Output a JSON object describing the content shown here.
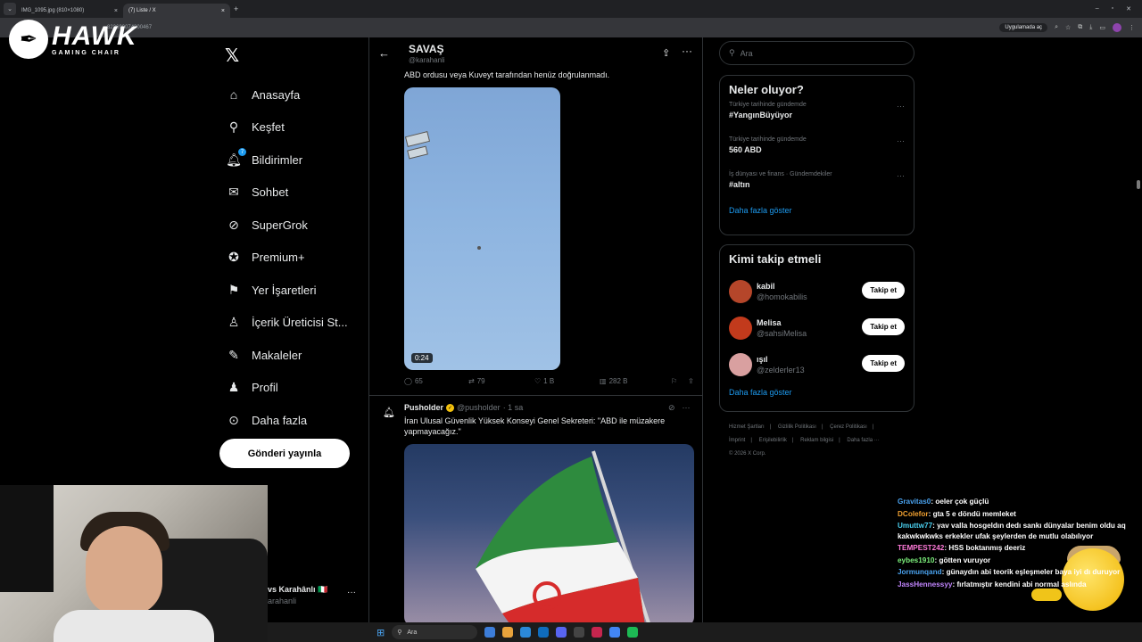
{
  "browser": {
    "tabs": [
      {
        "label": "IMG_1095.jpg (810×1080)",
        "close": "×"
      },
      {
        "label": "(7) Liste / X",
        "close": "×"
      }
    ],
    "new_tab": "+",
    "address": "822690074300467",
    "translate_pill": "Uygulamada aç"
  },
  "overlay_logo": {
    "title": "HAWK",
    "subtitle": "GAMING CHAIR"
  },
  "sidebar": {
    "logo": "𝕏",
    "items": [
      {
        "label": "Anasayfa",
        "icon": "home-icon"
      },
      {
        "label": "Keşfet",
        "icon": "search-icon"
      },
      {
        "label": "Bildirimler",
        "icon": "bell-icon",
        "badge": "7"
      },
      {
        "label": "Sohbet",
        "icon": "mail-icon"
      },
      {
        "label": "SuperGrok",
        "icon": "grok-icon"
      },
      {
        "label": "Premium+",
        "icon": "premium-icon"
      },
      {
        "label": "Yer İşaretleri",
        "icon": "bookmark-icon"
      },
      {
        "label": "İçerik Üreticisi St...",
        "icon": "creator-icon"
      },
      {
        "label": "Makaleler",
        "icon": "article-icon"
      },
      {
        "label": "Profil",
        "icon": "profile-icon"
      },
      {
        "label": "Daha fazla",
        "icon": "more-icon"
      }
    ],
    "post_button": "Gönderi yayınla",
    "account_name": "vs Karahânlı 🇮🇹",
    "account_handle": "arahanli"
  },
  "main": {
    "header_title": "SAVAŞ",
    "header_handle": "@karahanli",
    "tweet1": {
      "text": "ABD ordusu veya Kuveyt tarafından henüz doğrulanmadı.",
      "video_time": "0:24",
      "replies": "65",
      "retweets": "79",
      "likes": "1 B",
      "views": "282 B"
    },
    "tweet2": {
      "name": "Pusholder",
      "handle": "@pusholder",
      "time": "· 1 sa",
      "text": "İran Ulusal Güvenlik Yüksek Konseyi Genel Sekreteri: \"ABD ile müzakere yapmayacağız.\""
    }
  },
  "right": {
    "search_placeholder": "Ara",
    "trends_title": "Neler oluyor?",
    "trends": [
      {
        "context": "Türkiye tarihinde gündemde",
        "name": "#YangınBüyüyor"
      },
      {
        "context": "Türkiye tarihinde gündemde",
        "name": "560 ABD"
      },
      {
        "context": "İş dünyası ve finans · Gündemdekiler",
        "name": "#altın"
      }
    ],
    "trends_more": "Daha fazla göster",
    "follow_title": "Kimi takip etmeli",
    "follow": [
      {
        "name": "kabil",
        "handle": "@homokabilis",
        "button": "Takip et",
        "color": "#b5462a"
      },
      {
        "name": "Melisa",
        "handle": "@sahsiMelisa",
        "button": "Takip et",
        "color": "#c23a1c"
      },
      {
        "name": "ışıl",
        "handle": "@zelderler13",
        "button": "Takip et",
        "color": "#d9a0a0"
      }
    ],
    "follow_more": "Daha fazla göster",
    "footer": [
      "Hizmet Şartları",
      "|",
      "Gizlilik Politikası",
      "|",
      "Çerez Politikası",
      "|",
      "İmprint",
      "|",
      "Erişilebilirlik",
      "|",
      "Reklam bilgisi",
      "|",
      "Daha fazla ···",
      "© 2026 X Corp."
    ]
  },
  "chat": [
    {
      "user": "Gravitas0",
      "color": "#4aa3f0",
      "msg": ": oeler çok güçlü"
    },
    {
      "user": "DColefor",
      "color": "#f0a030",
      "msg": ": gta 5 e döndü memleket"
    },
    {
      "user": "Umuttw77",
      "color": "#4ad0f0",
      "msg": ": yav valla hosgeldın dedı sankı dünyalar benim oldu aq kakwkwkwks erkekler ufak şeylerden de mutlu olabılıyor"
    },
    {
      "user": "TEMPEST242",
      "color": "#ff7ad9",
      "msg": ": HSS boktanmış deeriz"
    },
    {
      "user": "eybes1910",
      "color": "#7cf07c",
      "msg": ": götten vuruyor"
    },
    {
      "user": "Jormunqand",
      "color": "#4aa3f0",
      "msg": ": günaydın abi teorik eşleşmeler baya iyi dı duruyor"
    },
    {
      "user": "JassHennessyy",
      "color": "#c084fc",
      "msg": ": fırlatmıştır kendini abi normal aslında"
    }
  ],
  "taskbar": {
    "search": "Ara"
  },
  "colors": {
    "accent": "#1d9bf0",
    "bg": "#000000",
    "border": "#2f3336",
    "muted": "#71767b"
  }
}
